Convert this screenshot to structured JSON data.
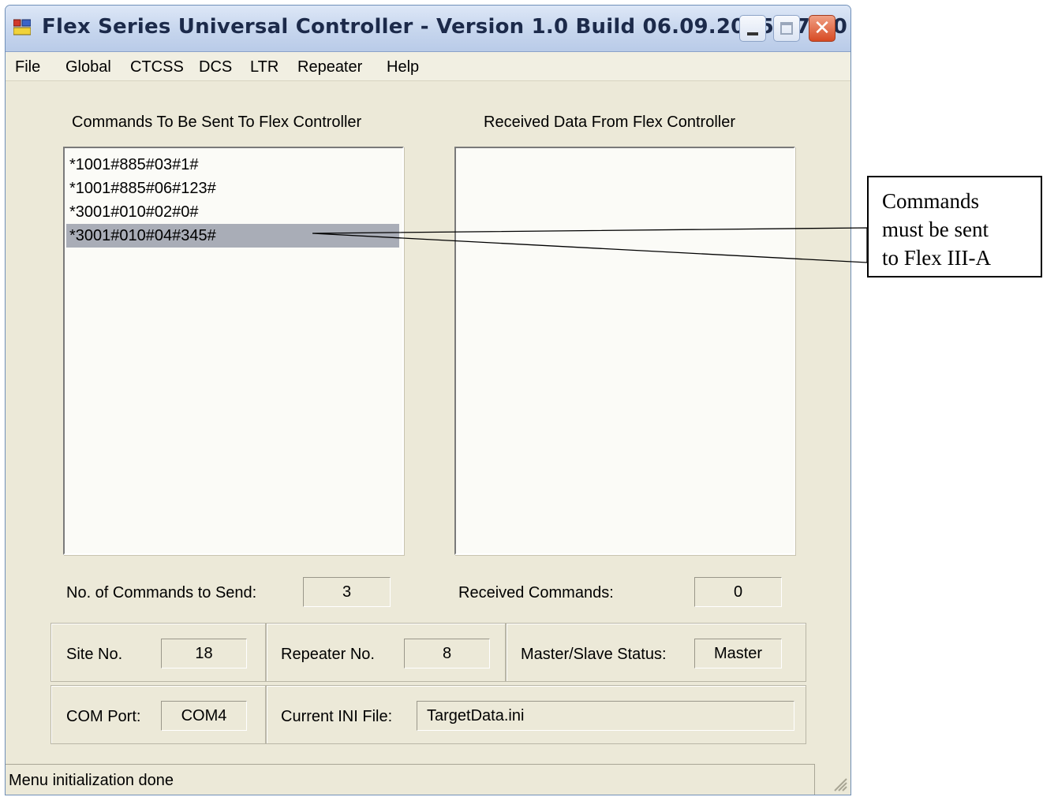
{
  "window": {
    "title": "Flex Series Universal Controller - Version 1.0 Build 06.09.2005 17:00",
    "buttons": {
      "close_glyph": "✕"
    }
  },
  "menu": [
    "File",
    "Global",
    "CTCSS",
    "DCS",
    "LTR",
    "Repeater",
    "Help"
  ],
  "send_panel": {
    "label": "Commands To Be Sent To Flex Controller",
    "items": [
      "*1001#885#03#1#",
      "*1001#885#06#123#",
      "*3001#010#02#0#",
      "*3001#010#04#345#"
    ],
    "selected_index": 3
  },
  "receive_panel": {
    "label": "Received Data From Flex Controller",
    "items": []
  },
  "counts": {
    "send_label": "No. of Commands to Send:",
    "send_value": "3",
    "received_label": "Received Commands:",
    "received_value": "0"
  },
  "info": {
    "site_label": "Site No.",
    "site_value": "18",
    "repeater_label": "Repeater No.",
    "repeater_value": "8",
    "status_label": "Master/Slave Status:",
    "status_value": "Master",
    "com_label": "COM Port:",
    "com_value": "COM4",
    "ini_label": "Current INI File:",
    "ini_value": "TargetData.ini"
  },
  "statusbar": {
    "text": "Menu initialization done"
  },
  "callout": {
    "lines": [
      "Commands",
      "must be sent",
      "to Flex III-A"
    ]
  },
  "icons": {
    "app": "app-icon",
    "minimize": "minimize-icon",
    "maximize": "maximize-icon",
    "close": "close-icon",
    "resize": "resize-grip-icon"
  },
  "colors": {
    "window_bg": "#ece9d8",
    "selection": "#a9adb7",
    "close_button": "#d74a23"
  }
}
